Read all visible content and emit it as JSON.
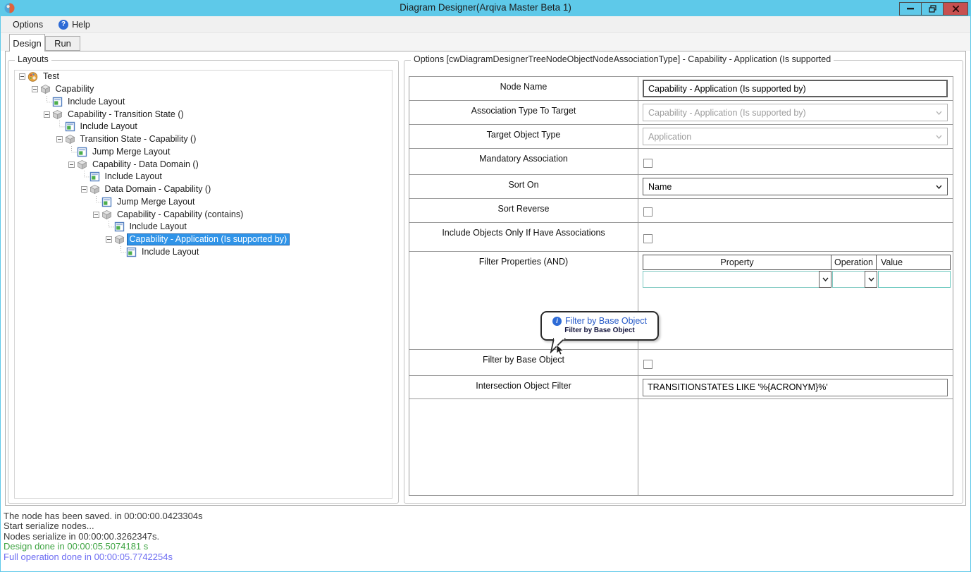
{
  "window": {
    "title": "Diagram Designer(Arqiva Master Beta 1)"
  },
  "menu": {
    "options_label": "Options",
    "help_label": "Help",
    "help_icon_glyph": "?"
  },
  "tabs": {
    "design_label": "Design",
    "run_label": "Run"
  },
  "layouts": {
    "title": "Layouts",
    "tree": [
      {
        "label": "Test",
        "icon": "palette-icon",
        "level": 0,
        "expander": true
      },
      {
        "label": "Capability",
        "icon": "cube-icon",
        "level": 1,
        "expander": true
      },
      {
        "label": "Include Layout",
        "icon": "layout-icon",
        "level": 2
      },
      {
        "label": "Capability - Transition State ()",
        "icon": "cube-icon",
        "level": 2,
        "expander": true
      },
      {
        "label": "Include Layout",
        "icon": "layout-icon",
        "level": 3
      },
      {
        "label": "Transition State - Capability ()",
        "icon": "cube-icon",
        "level": 3,
        "expander": true
      },
      {
        "label": "Jump Merge Layout",
        "icon": "layout-icon",
        "level": 4
      },
      {
        "label": "Capability - Data Domain ()",
        "icon": "cube-icon",
        "level": 4,
        "expander": true
      },
      {
        "label": "Include Layout",
        "icon": "layout-icon",
        "level": 5
      },
      {
        "label": "Data Domain - Capability ()",
        "icon": "cube-icon",
        "level": 5,
        "expander": true
      },
      {
        "label": "Jump Merge Layout",
        "icon": "layout-icon",
        "level": 6
      },
      {
        "label": "Capability - Capability (contains)",
        "icon": "cube-icon",
        "level": 6,
        "expander": true
      },
      {
        "label": "Include Layout",
        "icon": "layout-icon",
        "level": 7
      },
      {
        "label": "Capability - Application (Is supported by)",
        "icon": "cube-icon",
        "level": 7,
        "expander": true,
        "selected": true
      },
      {
        "label": "Include Layout",
        "icon": "layout-icon",
        "level": 8
      }
    ]
  },
  "options": {
    "title": "Options [cwDiagramDesignerTreeNodeObjectNodeAssociationType] - Capability - Application (Is supported",
    "rows": [
      {
        "label": "Node Name",
        "type": "text",
        "value": "Capability - Application (Is supported by)"
      },
      {
        "label": "Association Type To Target",
        "type": "select",
        "value": "Capability - Application (Is supported by)",
        "disabled": true
      },
      {
        "label": "Target Object Type",
        "type": "select",
        "value": "Application",
        "disabled": true
      },
      {
        "label": "Mandatory Association",
        "type": "checkbox",
        "checked": false
      },
      {
        "label": "Sort On",
        "type": "select",
        "value": "Name",
        "disabled": false
      },
      {
        "label": "Sort Reverse",
        "type": "checkbox",
        "checked": false
      },
      {
        "label": "Include Objects Only If Have Associations",
        "type": "checkbox",
        "checked": false
      },
      {
        "label": "Filter Properties (AND)",
        "type": "filtergrid"
      },
      {
        "label": "Filter by Base Object",
        "type": "checkbox",
        "checked": false
      },
      {
        "label": "Intersection Object Filter",
        "type": "text",
        "value": "TRANSITIONSTATES LIKE '%{ACRONYM}%'"
      },
      {
        "label": "",
        "type": "empty"
      }
    ],
    "filter_grid": {
      "columns": [
        "Property",
        "Operation",
        "Value"
      ],
      "row": {
        "property": "",
        "operation": "",
        "value": ""
      }
    }
  },
  "tooltip": {
    "title": "Filter by Base Object",
    "body": "Filter by Base Object"
  },
  "status": {
    "lines": [
      {
        "text": "The node has been saved. in 00:00:00.0423304s",
        "color": "#3A3A3A"
      },
      {
        "text": "Start serialize nodes...",
        "color": "#3A3A3A"
      },
      {
        "text": "Nodes serialize in 00:00:00.3262347s.",
        "color": "#3A3A3A"
      },
      {
        "text": "Design done in 00:00:05.5074181 s",
        "color": "#3FA443"
      },
      {
        "text": "Full operation done in 00:00:05.7742254s",
        "color": "#6D6DF2"
      }
    ]
  },
  "colors": {
    "titlebar": "#5EC9E9",
    "close_button": "#C75050",
    "selection_blue": "#3094E8",
    "grid_focus_teal": "#63C6BB",
    "status_green": "#3FA443",
    "status_blue": "#6D6DF2"
  }
}
